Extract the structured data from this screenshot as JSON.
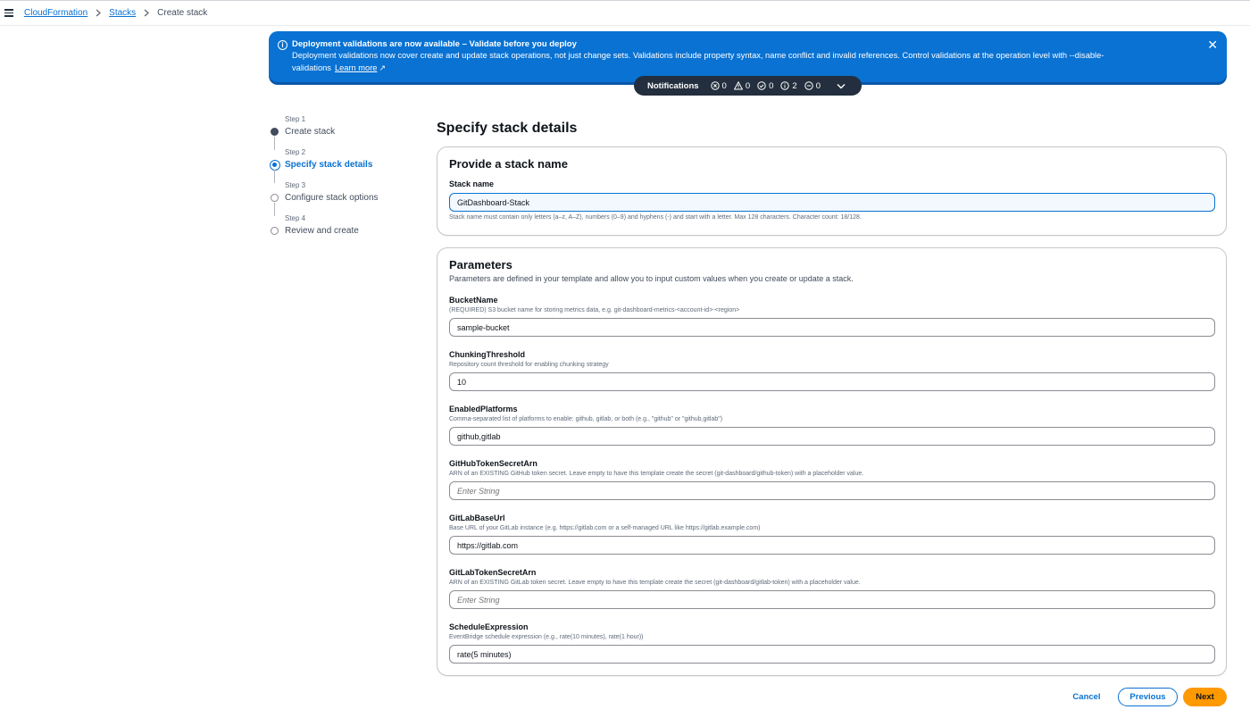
{
  "breadcrumb": {
    "items": [
      "CloudFormation",
      "Stacks"
    ],
    "current": "Create stack"
  },
  "flash": {
    "title": "Deployment validations are now available – Validate before you deploy",
    "body": "Deployment validations now cover create and update stack operations, not just change sets. Validations include property syntax, name conflict and invalid references. Control validations at the operation level with --disable-validations",
    "learn_more": "Learn more"
  },
  "notifications": {
    "label": "Notifications",
    "error_count": "0",
    "warning_count": "0",
    "success_count": "0",
    "info_count": "2",
    "in_progress_count": "0"
  },
  "steps": [
    {
      "num": "Step 1",
      "name": "Create stack",
      "state": "done"
    },
    {
      "num": "Step 2",
      "name": "Specify stack details",
      "state": "current"
    },
    {
      "num": "Step 3",
      "name": "Configure stack options",
      "state": "pending"
    },
    {
      "num": "Step 4",
      "name": "Review and create",
      "state": "pending"
    }
  ],
  "page_title": "Specify stack details",
  "stack_name_section": {
    "title": "Provide a stack name",
    "label": "Stack name",
    "value": "GitDashboard-Stack",
    "hint": "Stack name must contain only letters (a–z, A–Z), numbers (0–9) and hyphens (-) and start with a letter. Max 128 characters. Character count: 18/128."
  },
  "parameters": {
    "title": "Parameters",
    "description": "Parameters are defined in your template and allow you to input custom values when you create or update a stack.",
    "fields": [
      {
        "label": "BucketName",
        "desc": "(REQUIRED) S3 bucket name for storing metrics data, e.g. git-dashboard-metrics-<account-id>-<region>",
        "value": "sample-bucket",
        "placeholder": ""
      },
      {
        "label": "ChunkingThreshold",
        "desc": "Repository count threshold for enabling chunking strategy",
        "value": "10",
        "placeholder": ""
      },
      {
        "label": "EnabledPlatforms",
        "desc": "Comma-separated list of platforms to enable: github, gitlab, or both (e.g., \"github\" or \"github,gitlab\")",
        "value": "github,gitlab",
        "placeholder": ""
      },
      {
        "label": "GitHubTokenSecretArn",
        "desc": "ARN of an EXISTING GitHub token secret. Leave empty to have this template create the secret (git-dashboard/github-token) with a placeholder value.",
        "value": "",
        "placeholder": "Enter String"
      },
      {
        "label": "GitLabBaseUrl",
        "desc": "Base URL of your GitLab instance (e.g. https://gitlab.com or a self-managed URL like https://gitlab.example.com)",
        "value": "https://gitlab.com",
        "placeholder": ""
      },
      {
        "label": "GitLabTokenSecretArn",
        "desc": "ARN of an EXISTING GitLab token secret. Leave empty to have this template create the secret (git-dashboard/gitlab-token) with a placeholder value.",
        "value": "",
        "placeholder": "Enter String"
      },
      {
        "label": "ScheduleExpression",
        "desc": "EventBridge schedule expression (e.g., rate(10 minutes), rate(1 hour))",
        "value": "rate(5 minutes)",
        "placeholder": ""
      }
    ]
  },
  "footer": {
    "cancel": "Cancel",
    "previous": "Previous",
    "next": "Next"
  },
  "colors": {
    "accent": "#0972d3",
    "primary_button": "#ff9900",
    "notification_bar": "#232f3e"
  }
}
